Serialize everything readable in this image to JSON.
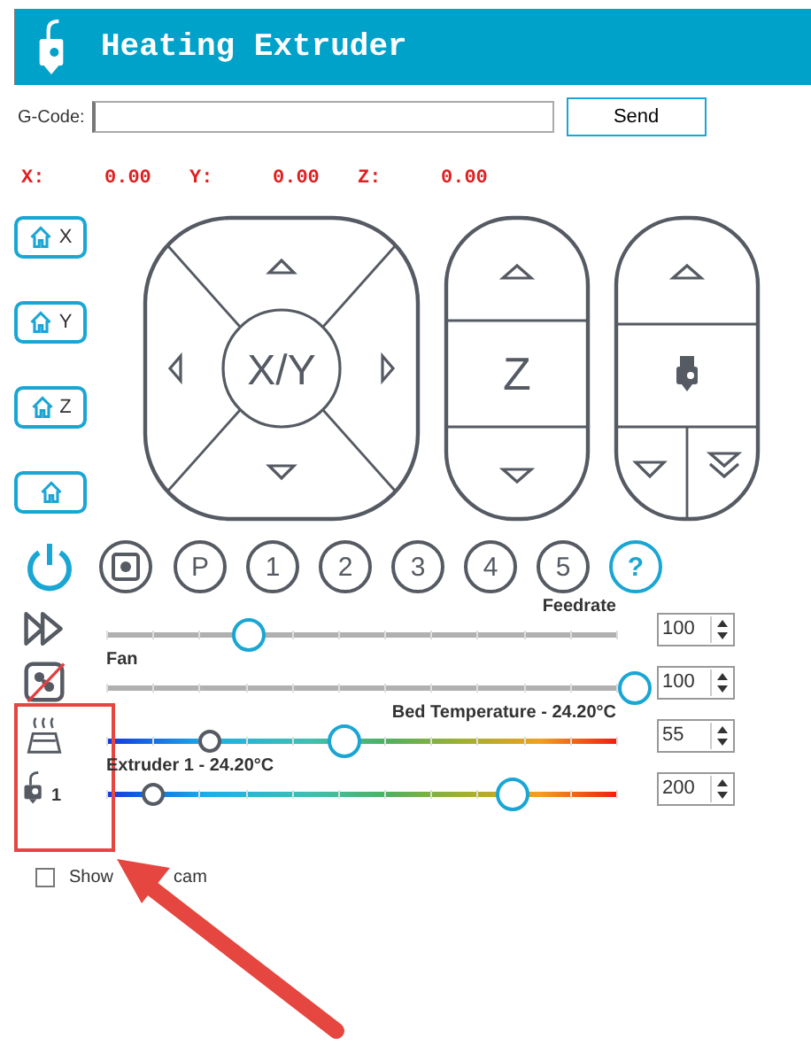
{
  "header": {
    "title": "Heating Extruder"
  },
  "gcode": {
    "label": "G-Code:",
    "button": "Send"
  },
  "position": [
    {
      "axis": "X:",
      "value": "0.00"
    },
    {
      "axis": "Y:",
      "value": "0.00"
    },
    {
      "axis": "Z:",
      "value": "0.00"
    }
  ],
  "home_buttons": [
    {
      "kind": "axis",
      "label": "X"
    },
    {
      "kind": "axis",
      "label": "Y"
    },
    {
      "kind": "axis",
      "label": "Z"
    },
    {
      "kind": "all"
    }
  ],
  "jog": {
    "xy_label": "X/Y",
    "z_label": "Z"
  },
  "toolbar": [
    {
      "kind": "power"
    },
    {
      "kind": "stop"
    },
    {
      "kind": "text",
      "label": "P"
    },
    {
      "kind": "text",
      "label": "1"
    },
    {
      "kind": "text",
      "label": "2"
    },
    {
      "kind": "text",
      "label": "3"
    },
    {
      "kind": "text",
      "label": "4"
    },
    {
      "kind": "text",
      "label": "5"
    },
    {
      "kind": "help",
      "label": "?"
    }
  ],
  "sliders": [
    {
      "kind": "plain",
      "label": "Feedrate",
      "level": 0.27,
      "value": "100"
    },
    {
      "kind": "plain",
      "label": "Fan",
      "level": 1.0,
      "value": "100"
    },
    {
      "kind": "temperature",
      "label": "Bed Temperature - 24.20°C",
      "level": 0.45,
      "current": {
        "level": 0.2
      },
      "value": "55"
    },
    {
      "kind": "temperature",
      "badge": "1",
      "label": "Extruder 1 - 24.20°C",
      "level": 0.77,
      "current": {
        "level": 0.09
      },
      "value": "200"
    }
  ],
  "webcam": {
    "checked": false,
    "label_start": "Show",
    "label_end": "cam"
  }
}
